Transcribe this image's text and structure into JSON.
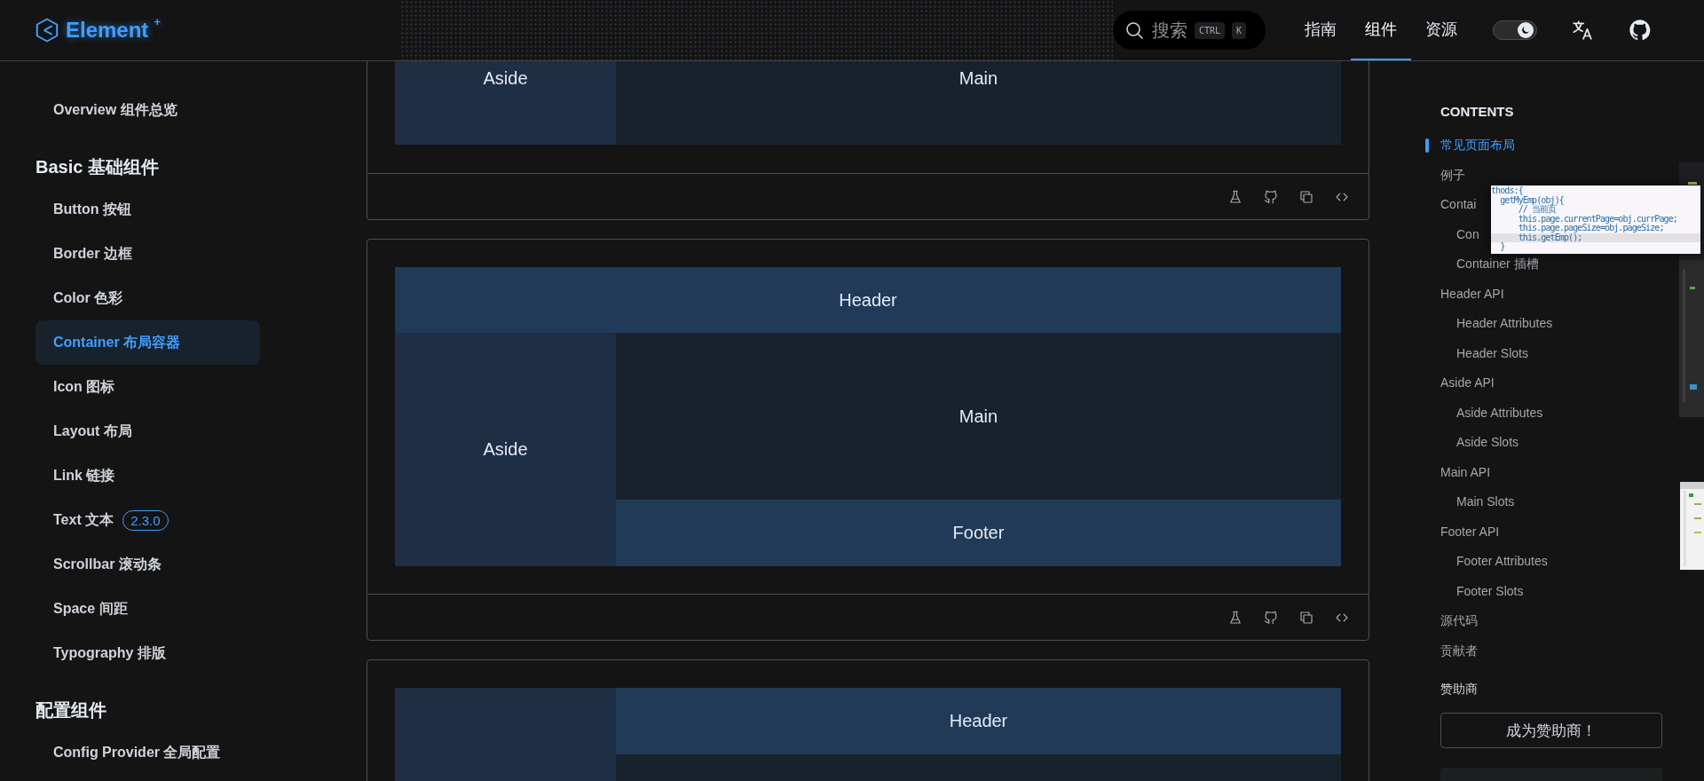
{
  "header": {
    "logo": "Element",
    "logo_sup": "+",
    "search": {
      "placeholder": "搜索",
      "keys": [
        "CTRL",
        "K"
      ]
    },
    "nav": [
      {
        "label": "指南",
        "selected": false
      },
      {
        "label": "组件",
        "selected": true
      },
      {
        "label": "资源",
        "selected": false
      }
    ],
    "dark_mode": {
      "on": true
    }
  },
  "sidebar": {
    "top_items": [
      {
        "label": "Overview 组件总览",
        "selected": false
      }
    ],
    "groups": [
      {
        "title": "Basic 基础组件",
        "items": [
          {
            "label": "Button 按钮",
            "selected": false
          },
          {
            "label": "Border 边框",
            "selected": false
          },
          {
            "label": "Color 色彩",
            "selected": false
          },
          {
            "label": "Container 布局容器",
            "selected": true
          },
          {
            "label": "Icon 图标",
            "selected": false
          },
          {
            "label": "Layout 布局",
            "selected": false
          },
          {
            "label": "Link 链接",
            "selected": false
          },
          {
            "label": "Text 文本",
            "selected": false,
            "badge": "2.3.0"
          },
          {
            "label": "Scrollbar 滚动条",
            "selected": false
          },
          {
            "label": "Space 间距",
            "selected": false
          },
          {
            "label": "Typography 排版",
            "selected": false
          }
        ]
      },
      {
        "title": "配置组件",
        "items": [
          {
            "label": "Config Provider 全局配置",
            "selected": false
          }
        ]
      }
    ]
  },
  "demos": [
    {
      "kind": "simple",
      "toolbar": true,
      "blocks": [
        {
          "kind": "aside",
          "label": "Aside"
        },
        {
          "kind": "main",
          "label": "Main"
        }
      ]
    },
    {
      "kind": "full",
      "toolbar": true,
      "blocks": [
        {
          "kind": "header",
          "label": "Header"
        },
        {
          "kind": "aside",
          "label": "Aside"
        },
        {
          "kind": "main",
          "label": "Main"
        },
        {
          "kind": "footer",
          "label": "Footer"
        }
      ]
    },
    {
      "kind": "split",
      "blocks": [
        {
          "kind": "aside"
        },
        {
          "kind": "header",
          "label": "Header"
        },
        {
          "kind": "main"
        }
      ]
    }
  ],
  "toc": {
    "title": "CONTENTS",
    "items": [
      {
        "label": "常见页面布局",
        "selected": true
      },
      {
        "label": "例子",
        "selected": false
      },
      {
        "label": "Contai",
        "selected": false,
        "children": [
          {
            "label": "Con",
            "selected": false
          },
          {
            "label": "Container 插槽",
            "selected": false
          }
        ]
      },
      {
        "label": "Header API",
        "selected": false,
        "children": [
          {
            "label": "Header Attributes",
            "selected": false
          },
          {
            "label": "Header Slots",
            "selected": false
          }
        ]
      },
      {
        "label": "Aside API",
        "selected": false,
        "children": [
          {
            "label": "Aside Attributes",
            "selected": false
          },
          {
            "label": "Aside Slots",
            "selected": false
          }
        ]
      },
      {
        "label": "Main API",
        "selected": false,
        "children": [
          {
            "label": "Main Slots",
            "selected": false
          }
        ]
      },
      {
        "label": "Footer API",
        "selected": false,
        "children": [
          {
            "label": "Footer Attributes",
            "selected": false
          },
          {
            "label": "Footer Slots",
            "selected": false
          }
        ]
      },
      {
        "label": "源代码",
        "selected": false
      },
      {
        "label": "贡献者",
        "selected": false
      }
    ],
    "sponsor_title": "赞助商",
    "sponsor_button": "成为赞助商！"
  },
  "code_popup": {
    "lines": [
      "thods:{",
      "  getMyEmp(obj){",
      "      // 当前页",
      "      this.page.currentPage=obj.currPage;",
      "      this.page.pageSize=obj.pageSize;",
      "      this.getEmp();",
      "  }"
    ]
  }
}
